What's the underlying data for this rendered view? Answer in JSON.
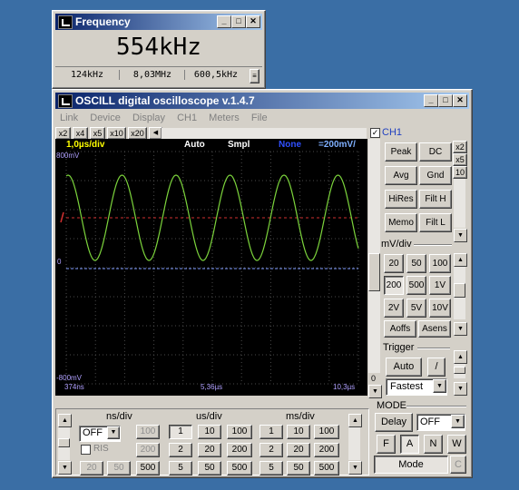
{
  "freq_window": {
    "title": "Frequency",
    "value": "554kHz",
    "readouts": [
      "124kHz",
      "8,03MHz",
      "600,5kHz"
    ]
  },
  "osc_window": {
    "title": "OSCILL digital oscilloscope  v.1.4.7",
    "menu": [
      "Link",
      "Device",
      "Display",
      "CH1",
      "Meters",
      "File"
    ],
    "zoom_buttons": [
      "x2",
      "x4",
      "x5",
      "x10",
      "x20"
    ],
    "status": {
      "timebase": "1,0µs/div",
      "trigger_mode": "Auto",
      "sampling": "Smpl",
      "channel_state": "None",
      "volts": "=200mV/"
    },
    "screen": {
      "top_label": "800mV",
      "zero_label": "0",
      "bottom_label": "-800mV",
      "time_left": "374ns",
      "time_mid": "5,36µs",
      "time_right": "10,3µs"
    },
    "side_scale": "0",
    "ch1": {
      "label": "CH1",
      "buttons": [
        "Peak",
        "DC",
        "Avg",
        "Gnd",
        "HiRes",
        "Filt H",
        "Memo",
        "Filt L"
      ],
      "mult_buttons": [
        "x2",
        "x5",
        "10"
      ]
    },
    "mv_div": {
      "label": "mV/div",
      "buttons": [
        "20",
        "50",
        "100",
        "200",
        "500",
        "1V",
        "2V",
        "5V",
        "10V"
      ],
      "aoffs": "Aoffs",
      "asens": "Asens"
    },
    "trigger": {
      "label": "Trigger",
      "auto": "Auto",
      "slope": "/",
      "speed": "Fastest"
    },
    "ns_div": {
      "label": "ns/div",
      "select": "OFF",
      "ris": "RIS",
      "buttons": [
        "100",
        "200",
        "20",
        "50",
        "500"
      ]
    },
    "us_div": {
      "label": "us/div",
      "buttons": [
        "1",
        "10",
        "100",
        "2",
        "20",
        "200",
        "5",
        "50",
        "500"
      ]
    },
    "ms_div": {
      "label": "ms/div",
      "buttons": [
        "1",
        "10",
        "100",
        "2",
        "20",
        "200",
        "5",
        "50",
        "500"
      ]
    },
    "mode": {
      "label": "MODE",
      "delay": "Delay",
      "delay_select": "OFF",
      "buttons": [
        "F",
        "A",
        "N",
        "W"
      ],
      "mode_button": "Mode",
      "c_button": "C"
    }
  },
  "colors": {
    "waveform": "#7cd43c",
    "status_yellow": "#ffff00",
    "status_blue": "#3050ff",
    "label_violet": "#b0a0ff",
    "trigger_level": "#d03030"
  }
}
